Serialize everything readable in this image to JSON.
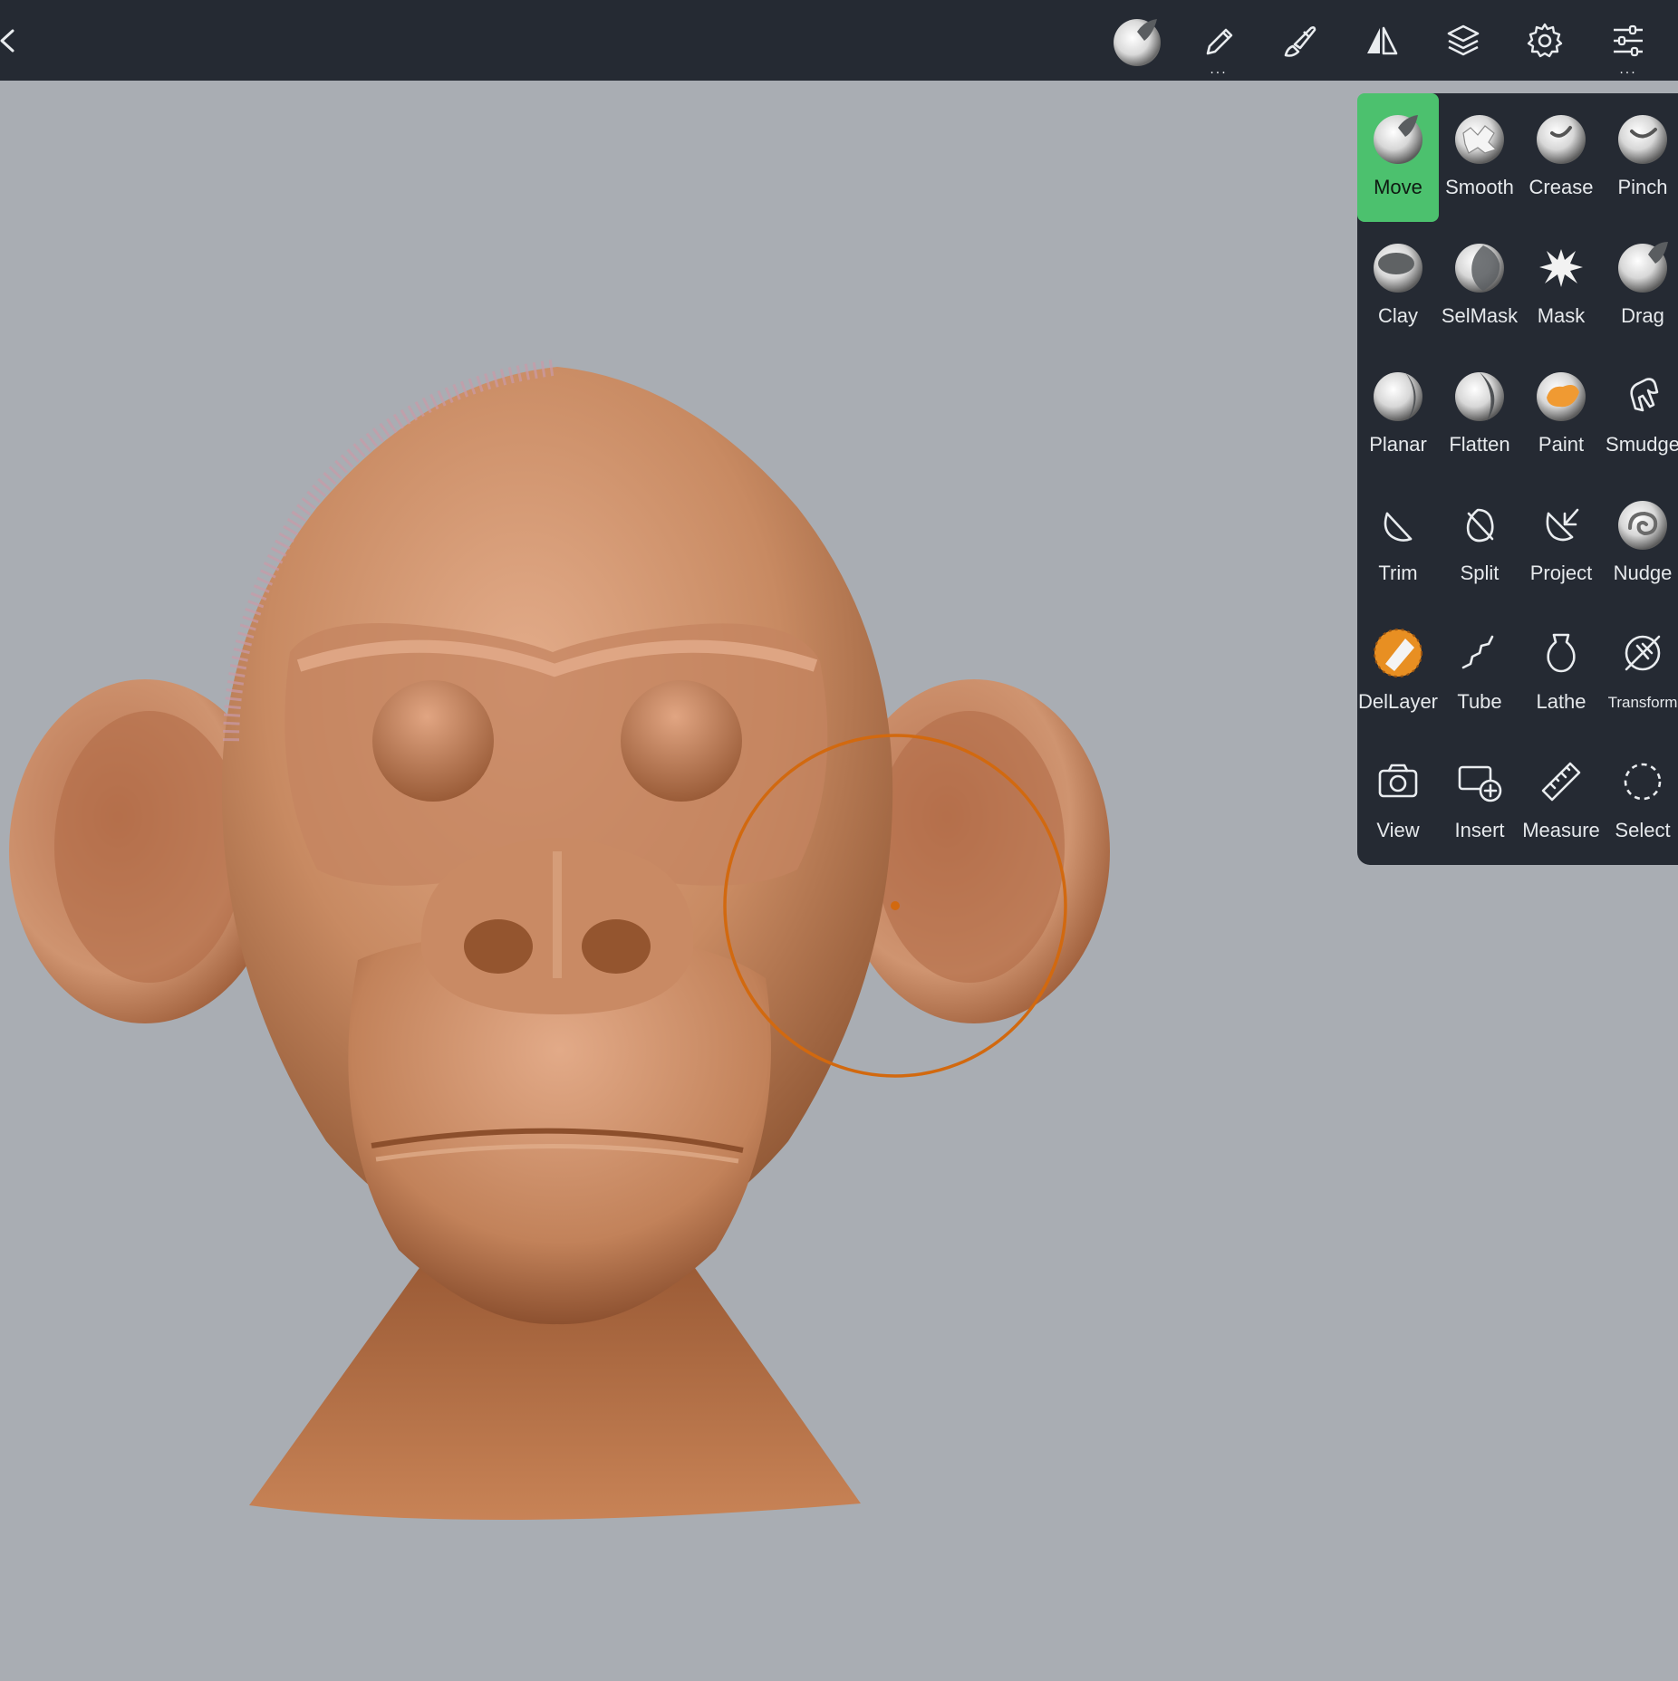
{
  "colors": {
    "topbar": "#252a33",
    "viewport": "#a9adb3",
    "accent_active": "#4cc16e",
    "cursor": "#d2690f",
    "skin": "#c98a62"
  },
  "topbar": {
    "icons": [
      {
        "name": "move-brush-sphere-icon",
        "has_more": false
      },
      {
        "name": "brush-pen-icon",
        "has_more": true
      },
      {
        "name": "paint-brush-icon",
        "has_more": false
      },
      {
        "name": "symmetry-icon",
        "has_more": false
      },
      {
        "name": "layers-icon",
        "has_more": false
      },
      {
        "name": "settings-gear-icon",
        "has_more": false
      },
      {
        "name": "sliders-icon",
        "has_more": true
      }
    ],
    "more_indicator": "..."
  },
  "tools": {
    "active": "Move",
    "rows": [
      [
        {
          "label": "Move",
          "icon": "move-icon"
        },
        {
          "label": "Smooth",
          "icon": "smooth-icon"
        },
        {
          "label": "Crease",
          "icon": "crease-icon"
        },
        {
          "label": "Pinch",
          "icon": "pinch-icon"
        }
      ],
      [
        {
          "label": "Clay",
          "icon": "clay-icon"
        },
        {
          "label": "SelMask",
          "icon": "selmask-icon"
        },
        {
          "label": "Mask",
          "icon": "mask-icon"
        },
        {
          "label": "Drag",
          "icon": "drag-icon"
        }
      ],
      [
        {
          "label": "Planar",
          "icon": "planar-icon"
        },
        {
          "label": "Flatten",
          "icon": "flatten-icon"
        },
        {
          "label": "Paint",
          "icon": "paint-icon"
        },
        {
          "label": "Smudge",
          "icon": "smudge-icon"
        }
      ],
      [
        {
          "label": "Trim",
          "icon": "trim-icon"
        },
        {
          "label": "Split",
          "icon": "split-icon"
        },
        {
          "label": "Project",
          "icon": "project-icon"
        },
        {
          "label": "Nudge",
          "icon": "nudge-icon"
        }
      ],
      [
        {
          "label": "DelLayer",
          "icon": "dellayer-icon"
        },
        {
          "label": "Tube",
          "icon": "tube-icon"
        },
        {
          "label": "Lathe",
          "icon": "lathe-icon"
        },
        {
          "label": "Transform",
          "icon": "transform-icon"
        }
      ],
      [
        {
          "label": "View",
          "icon": "camera-icon"
        },
        {
          "label": "Insert",
          "icon": "insert-icon"
        },
        {
          "label": "Measure",
          "icon": "ruler-icon"
        },
        {
          "label": "Select",
          "icon": "select-lasso-icon"
        }
      ]
    ]
  }
}
